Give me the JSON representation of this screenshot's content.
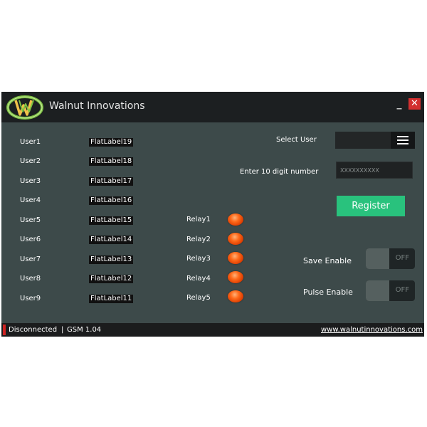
{
  "window": {
    "title": "Walnut Innovations",
    "logo_letters": "W",
    "minimize_symbol": "_",
    "close_symbol": "✕"
  },
  "users": [
    {
      "label": "User1",
      "value": "FlatLabel19"
    },
    {
      "label": "User2",
      "value": "FlatLabel18"
    },
    {
      "label": "User3",
      "value": "FlatLabel17"
    },
    {
      "label": "User4",
      "value": "FlatLabel16"
    },
    {
      "label": "User5",
      "value": "FlatLabel15"
    },
    {
      "label": "User6",
      "value": "FlatLabel14"
    },
    {
      "label": "User7",
      "value": "FlatLabel13"
    },
    {
      "label": "User8",
      "value": "FlatLabel12"
    },
    {
      "label": "User9",
      "value": "FlatLabel11"
    }
  ],
  "relays": [
    {
      "label": "Relay1",
      "state_color": "#ff5a12"
    },
    {
      "label": "Relay2",
      "state_color": "#ff5a12"
    },
    {
      "label": "Relay3",
      "state_color": "#ff5a12"
    },
    {
      "label": "Relay4",
      "state_color": "#ff5a12"
    },
    {
      "label": "Relay5",
      "state_color": "#ff5a12"
    }
  ],
  "form": {
    "select_user_label": "Select User",
    "phone_label": "Enter 10 digit number",
    "phone_placeholder": "XXXXXXXXXX",
    "register_label": "Register",
    "save_enable_label": "Save Enable",
    "save_enable_state": "OFF",
    "pulse_enable_label": "Pulse Enable",
    "pulse_enable_state": "OFF"
  },
  "status": {
    "connection": "Disconnected",
    "separator": "|",
    "version": "GSM 1.04",
    "website": "www.walnutinnovations.com"
  },
  "colors": {
    "background": "#3d4a4a",
    "titlebar": "#1c1f21",
    "accent_green": "#29c27d",
    "close_red": "#d32f2f",
    "relay_led": "#ff5a12",
    "status_red": "#d02222"
  }
}
